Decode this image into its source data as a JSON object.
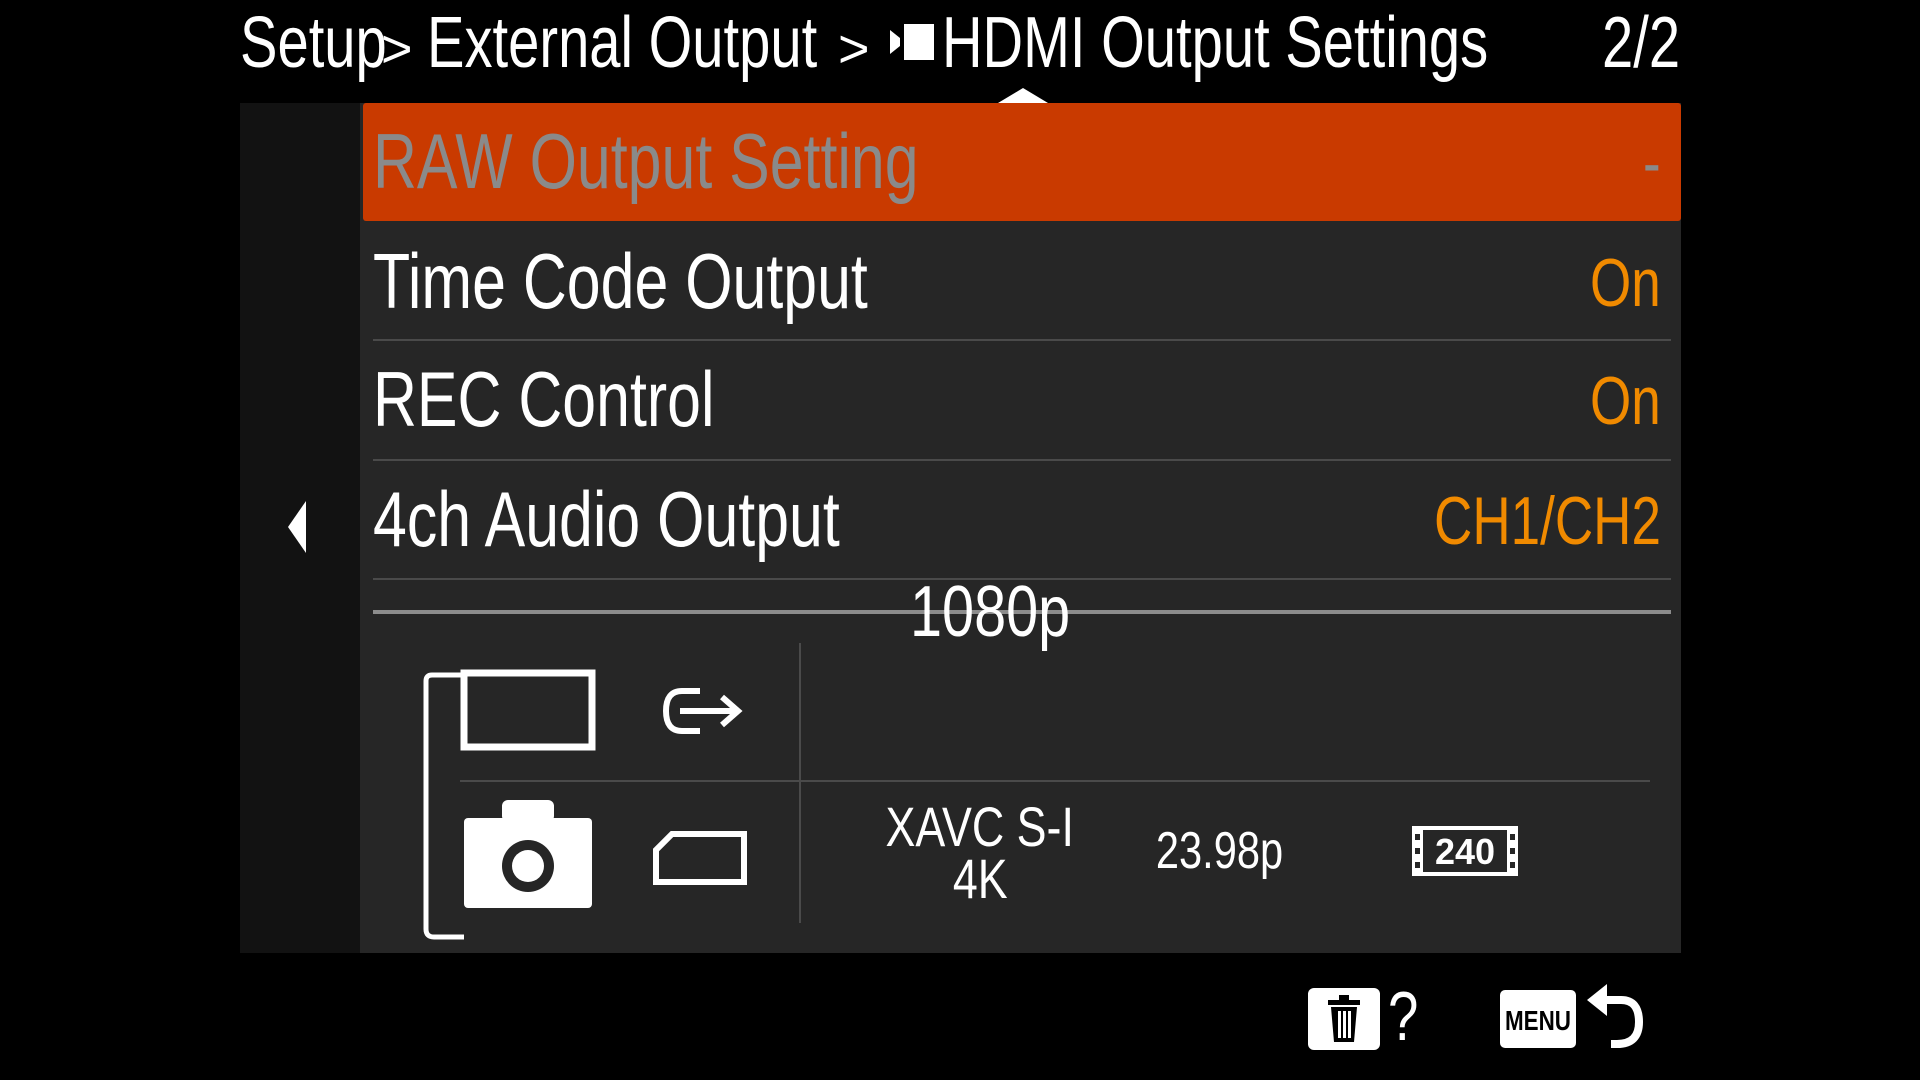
{
  "header": {
    "breadcrumb": [
      "Setup",
      "External Output",
      "HDMI Output Settings"
    ],
    "separator": ">",
    "page_indicator": "2/2"
  },
  "menu": {
    "items": [
      {
        "label": "RAW Output Setting",
        "value": "-",
        "selected": true
      },
      {
        "label": "Time Code Output",
        "value": "On",
        "selected": false
      },
      {
        "label": "REC Control",
        "value": "On",
        "selected": false
      },
      {
        "label": "4ch Audio Output",
        "value": "CH1/CH2",
        "selected": false
      }
    ]
  },
  "output_info": {
    "hdmi_resolution": "1080p",
    "rec_format": [
      "XAVC S-I",
      "4K"
    ],
    "rec_framerate": "23.98p",
    "bitrate": "240"
  },
  "footer": {
    "help": "?",
    "menu_label": "MENU"
  },
  "colors": {
    "accent_orange": "#f08a00",
    "selected_bg": "#c93a00",
    "panel_bg": "#262626"
  },
  "icons": [
    "movie-mode-icon",
    "left-arrow-icon",
    "external-monitor-icon",
    "hdmi-out-icon",
    "camera-icon",
    "memory-card-icon",
    "trash-icon",
    "help-icon",
    "menu-icon",
    "back-icon"
  ]
}
